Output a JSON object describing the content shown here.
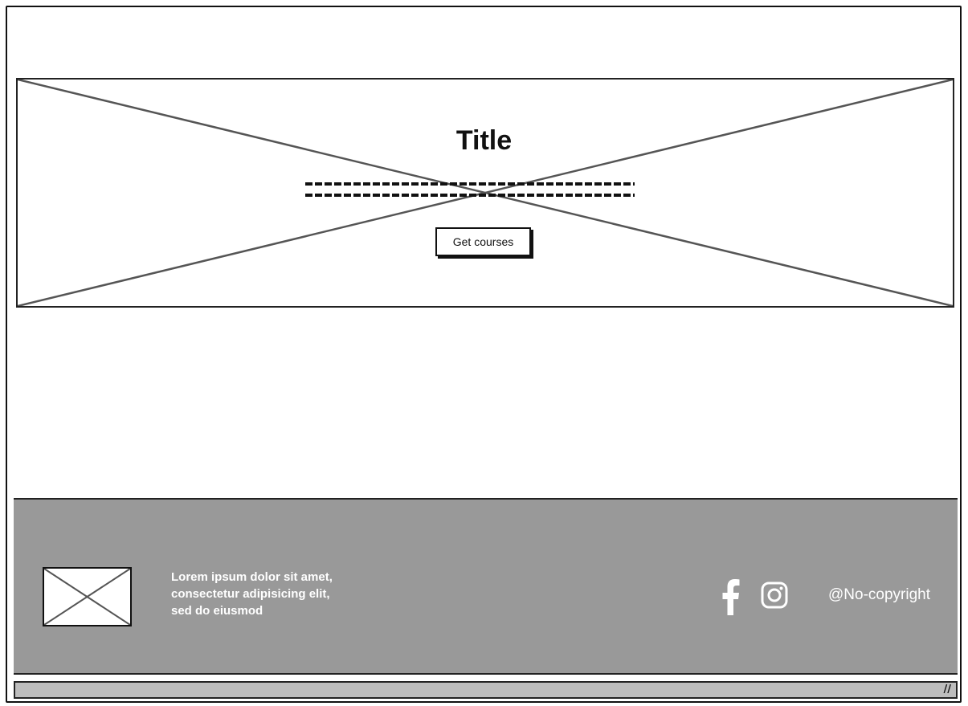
{
  "hero": {
    "title": "Title",
    "button_label": "Get courses"
  },
  "footer": {
    "text_lines": [
      "Lorem ipsum dolor sit amet,",
      "consectetur adipisicing elit,",
      "sed do eiusmod"
    ],
    "icons": [
      "facebook-icon",
      "instagram-icon"
    ],
    "copyright": "@No-copyright"
  },
  "colors": {
    "footer_bg": "#999999",
    "scrollbar_bg": "#bdbdbd"
  }
}
